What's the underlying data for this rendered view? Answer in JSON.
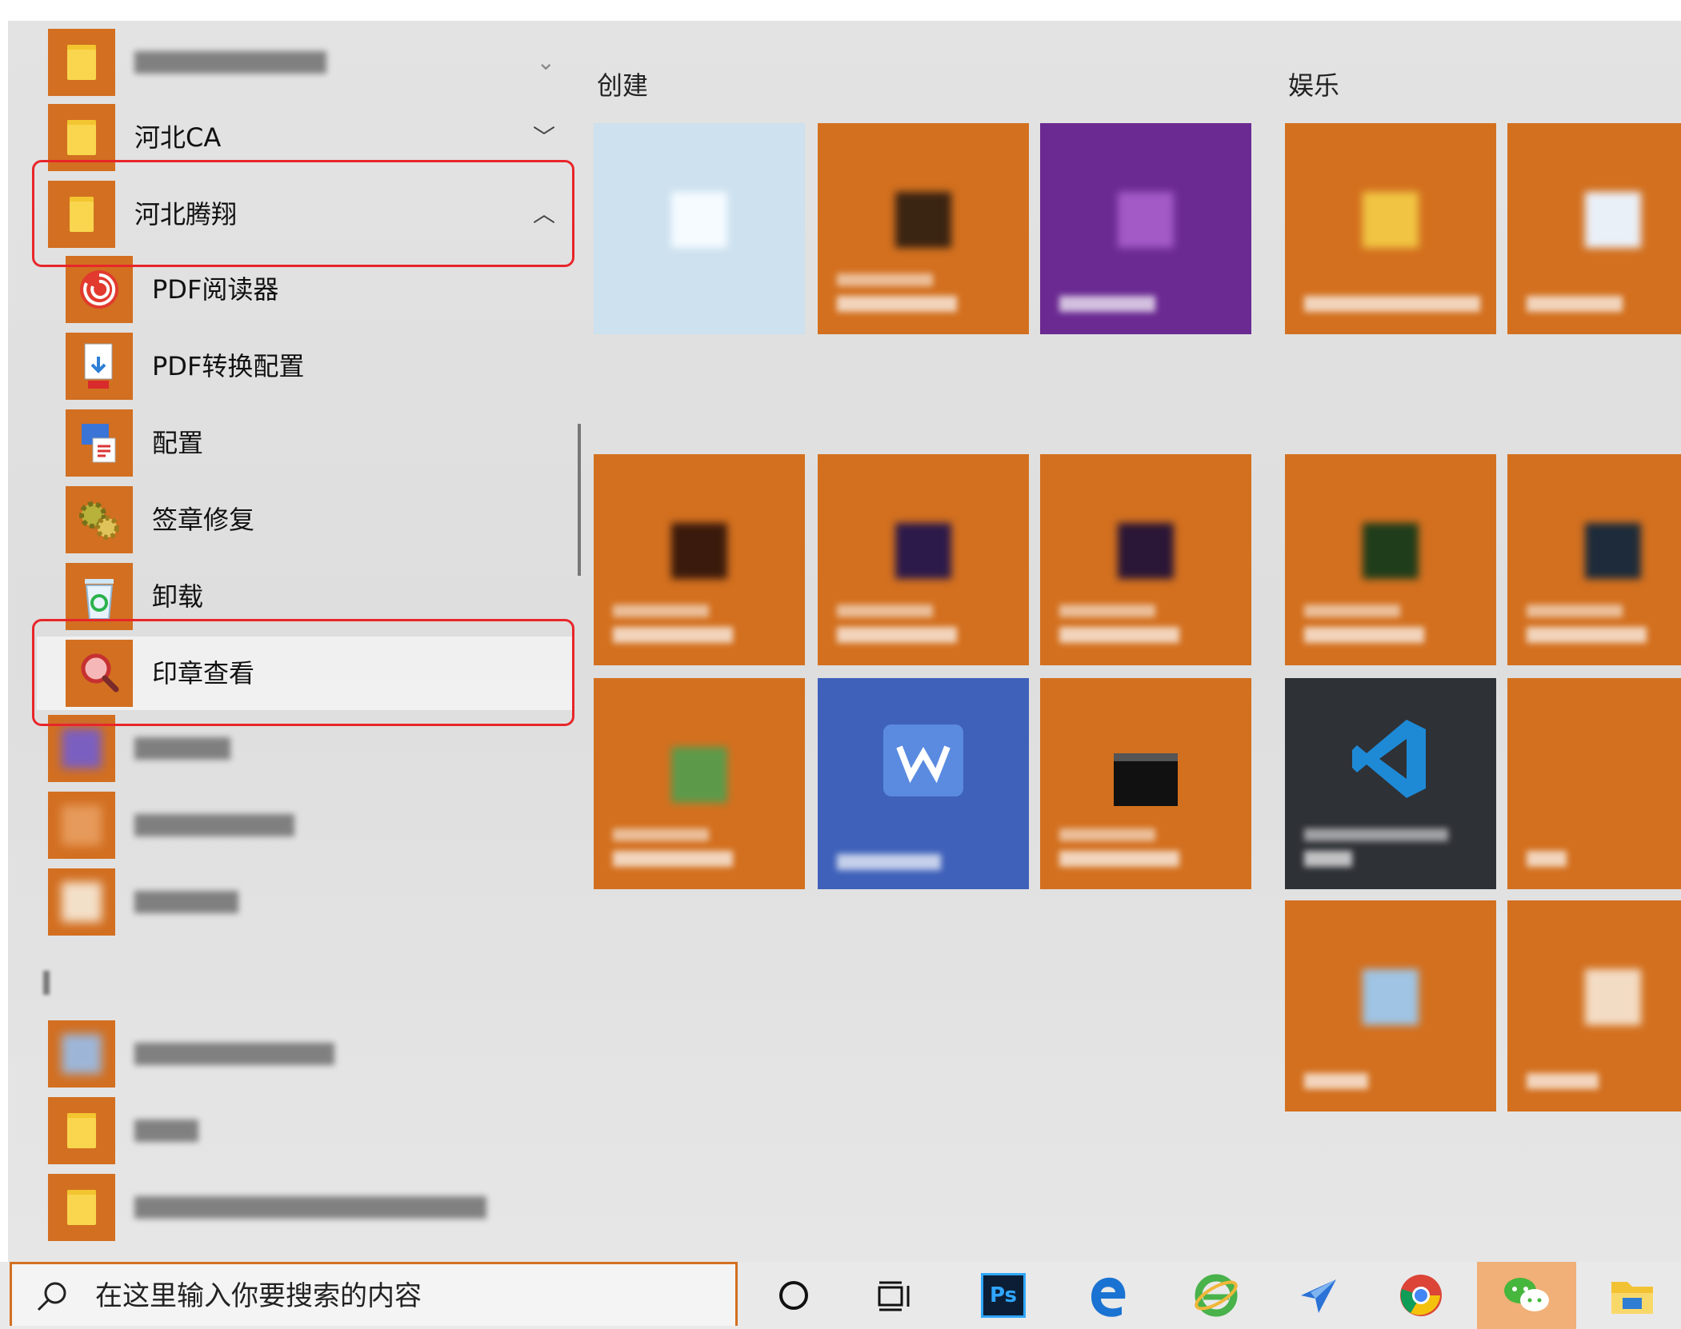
{
  "start_menu": {
    "app_list": [
      {
        "label": "",
        "icon": "folder-icon",
        "blurred": true,
        "chevron": ""
      },
      {
        "label": "河北CA",
        "icon": "folder-icon",
        "chevron": "﹀"
      },
      {
        "label": "河北腾翔",
        "icon": "folder-icon",
        "chevron": "︿",
        "expanded": true
      },
      {
        "label": "PDF阅读器",
        "icon": "pdf-reader-icon",
        "sub": true
      },
      {
        "label": "PDF转换配置",
        "icon": "pdf-convert-icon",
        "sub": true
      },
      {
        "label": "配置",
        "icon": "config-icon",
        "sub": true
      },
      {
        "label": "签章修复",
        "icon": "gear-repair-icon",
        "sub": true
      },
      {
        "label": "卸载",
        "icon": "recycle-bin-icon",
        "sub": true
      },
      {
        "label": "印章查看",
        "icon": "seal-view-icon",
        "sub": true,
        "hover": true
      }
    ],
    "groups": [
      {
        "title": "创建"
      },
      {
        "title": "娱乐"
      }
    ]
  },
  "taskbar": {
    "search_placeholder": "在这里输入你要搜索的内容",
    "icons": [
      "cortana-icon",
      "task-view-icon",
      "photoshop-icon",
      "edge-icon",
      "ie-icon",
      "feishu-icon",
      "chrome-icon",
      "wechat-icon",
      "file-explorer-icon"
    ],
    "photoshop_label": "Ps"
  },
  "colors": {
    "tile_orange": "#d3701f",
    "highlight_red": "#e8262a",
    "onenote_purple": "#6b2a92",
    "blue_tile": "#3f61ba",
    "vscode_dark": "#2e3136"
  }
}
